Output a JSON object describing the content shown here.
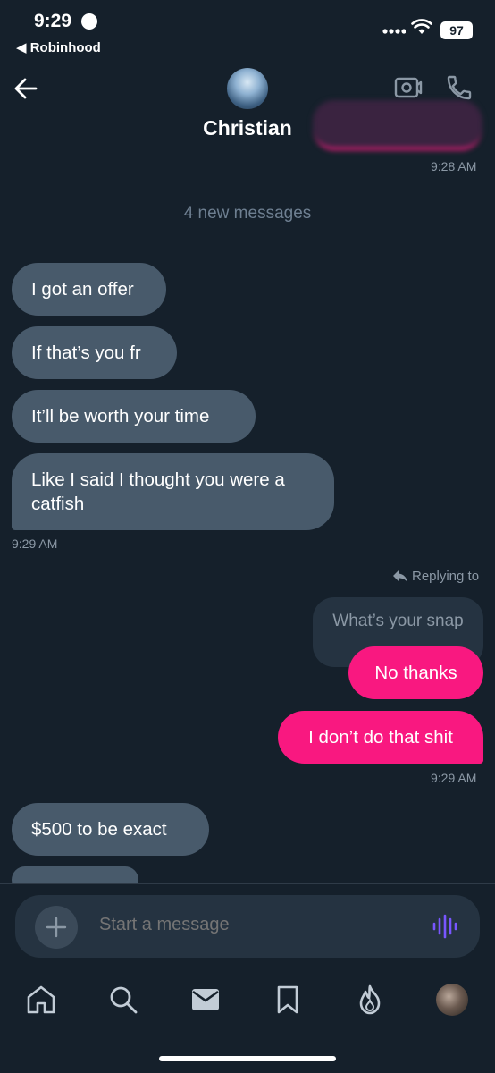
{
  "status_bar": {
    "time": "9:29",
    "back_app": "◀ Robinhood",
    "battery": "97"
  },
  "header": {
    "contact_name": "Christian"
  },
  "conversation": {
    "prev_timestamp": "9:28 AM",
    "divider": "4 new messages",
    "incoming_group1": [
      "I got an offer",
      "If that’s you fr",
      "It’ll be worth your time",
      "Like I said I thought you were a catfish"
    ],
    "incoming_timestamp1": "9:29 AM",
    "replying_to": "Replying to",
    "quoted_message": "What’s your snap",
    "outgoing": [
      "No thanks",
      "I don’t do that shit"
    ],
    "outgoing_timestamp": "9:29 AM",
    "incoming_group2": [
      "$500 to be exact"
    ]
  },
  "composer": {
    "placeholder": "Start a message"
  },
  "colors": {
    "background": "#15202b",
    "incoming_bubble": "#485a6b",
    "outgoing_bubble": "#f91880",
    "voice_accent": "#7856ff"
  },
  "tab_bar": {
    "icons": [
      "home-icon",
      "search-icon",
      "messages-icon",
      "bookmark-icon",
      "flame-icon",
      "profile-avatar"
    ],
    "active": "messages-icon"
  }
}
